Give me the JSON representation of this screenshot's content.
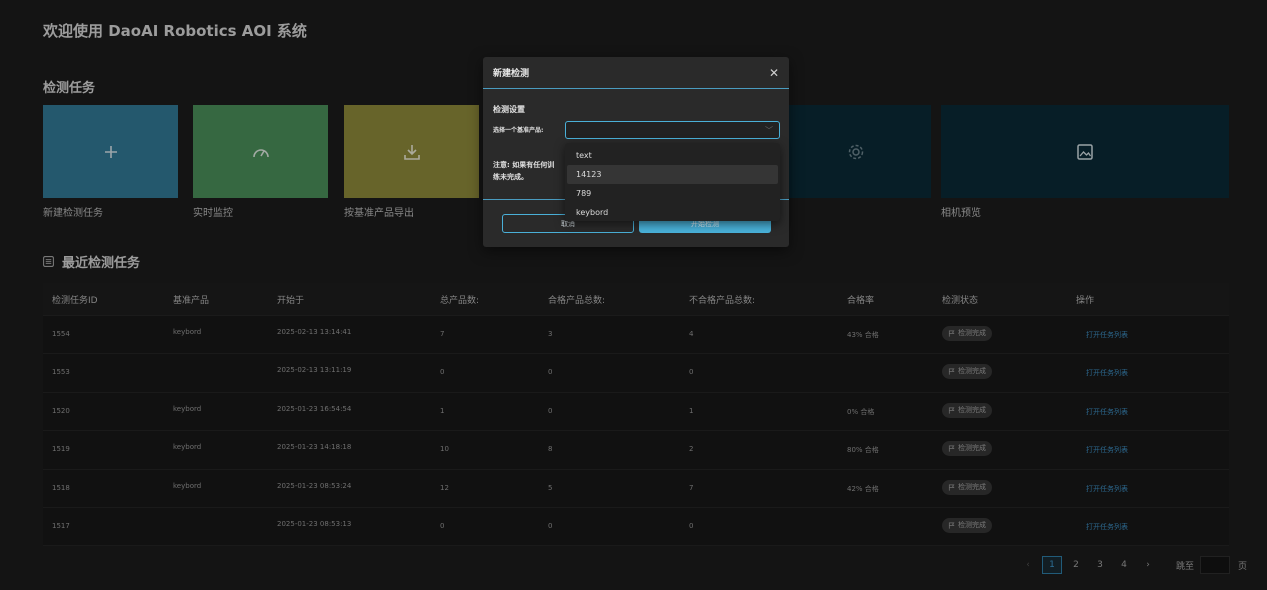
{
  "page": {
    "title": "欢迎使用 DaoAI Robotics AOI 系统"
  },
  "tasks": {
    "section_title": "检测任务",
    "cards": [
      {
        "label": "新建检测任务",
        "icon": "plus-icon",
        "color": "#327a98"
      },
      {
        "label": "实时监控",
        "icon": "gauge-icon",
        "color": "#4b915a"
      },
      {
        "label": "按基准产品导出",
        "icon": "download-icon",
        "color": "#8f8b3b"
      },
      {
        "label": "",
        "icon": "gear-icon",
        "color": "#0b2a36"
      },
      {
        "label": "相机预览",
        "icon": "image-icon",
        "color": "#0b2a36"
      }
    ]
  },
  "recent": {
    "title": "最近检测任务",
    "columns": [
      "检测任务ID",
      "基准产品",
      "开始于",
      "总产品数:",
      "合格产品总数:",
      "不合格产品总数:",
      "合格率",
      "检测状态",
      "操作"
    ],
    "rows": [
      {
        "id": "1554",
        "product": "keybord",
        "start": "2025-02-13 13:14:41",
        "total": "7",
        "pass": "3",
        "fail": "4",
        "rate": "43% 合格",
        "status": "检测完成",
        "action": "打开任务列表"
      },
      {
        "id": "1553",
        "product": "",
        "start": "2025-02-13 13:11:19",
        "total": "0",
        "pass": "0",
        "fail": "0",
        "rate": "",
        "status": "检测完成",
        "action": "打开任务列表"
      },
      {
        "id": "1520",
        "product": "keybord",
        "start": "2025-01-23 16:54:54",
        "total": "1",
        "pass": "0",
        "fail": "1",
        "rate": "0% 合格",
        "status": "检测完成",
        "action": "打开任务列表"
      },
      {
        "id": "1519",
        "product": "keybord",
        "start": "2025-01-23 14:18:18",
        "total": "10",
        "pass": "8",
        "fail": "2",
        "rate": "80% 合格",
        "status": "检测完成",
        "action": "打开任务列表"
      },
      {
        "id": "1518",
        "product": "keybord",
        "start": "2025-01-23 08:53:24",
        "total": "12",
        "pass": "5",
        "fail": "7",
        "rate": "42% 合格",
        "status": "检测完成",
        "action": "打开任务列表"
      },
      {
        "id": "1517",
        "product": "",
        "start": "2025-01-23 08:53:13",
        "total": "0",
        "pass": "0",
        "fail": "0",
        "rate": "",
        "status": "检测完成",
        "action": "打开任务列表"
      }
    ]
  },
  "pagination": {
    "prev": "‹",
    "pages": [
      "1",
      "2",
      "3",
      "4"
    ],
    "active": "1",
    "next": "›",
    "jump_label": "跳至",
    "page_label": "页"
  },
  "modal": {
    "title": "新建检测",
    "close": "✕",
    "section": "检测设置",
    "field_label": "选择一个基准产品:",
    "note": "注意: 如果有任何训练未完成。",
    "cancel_label": "取消",
    "start_label": "开始检测"
  },
  "dropdown": {
    "options": [
      "text",
      "14123",
      "789",
      "keybord"
    ],
    "hovered": "14123"
  }
}
